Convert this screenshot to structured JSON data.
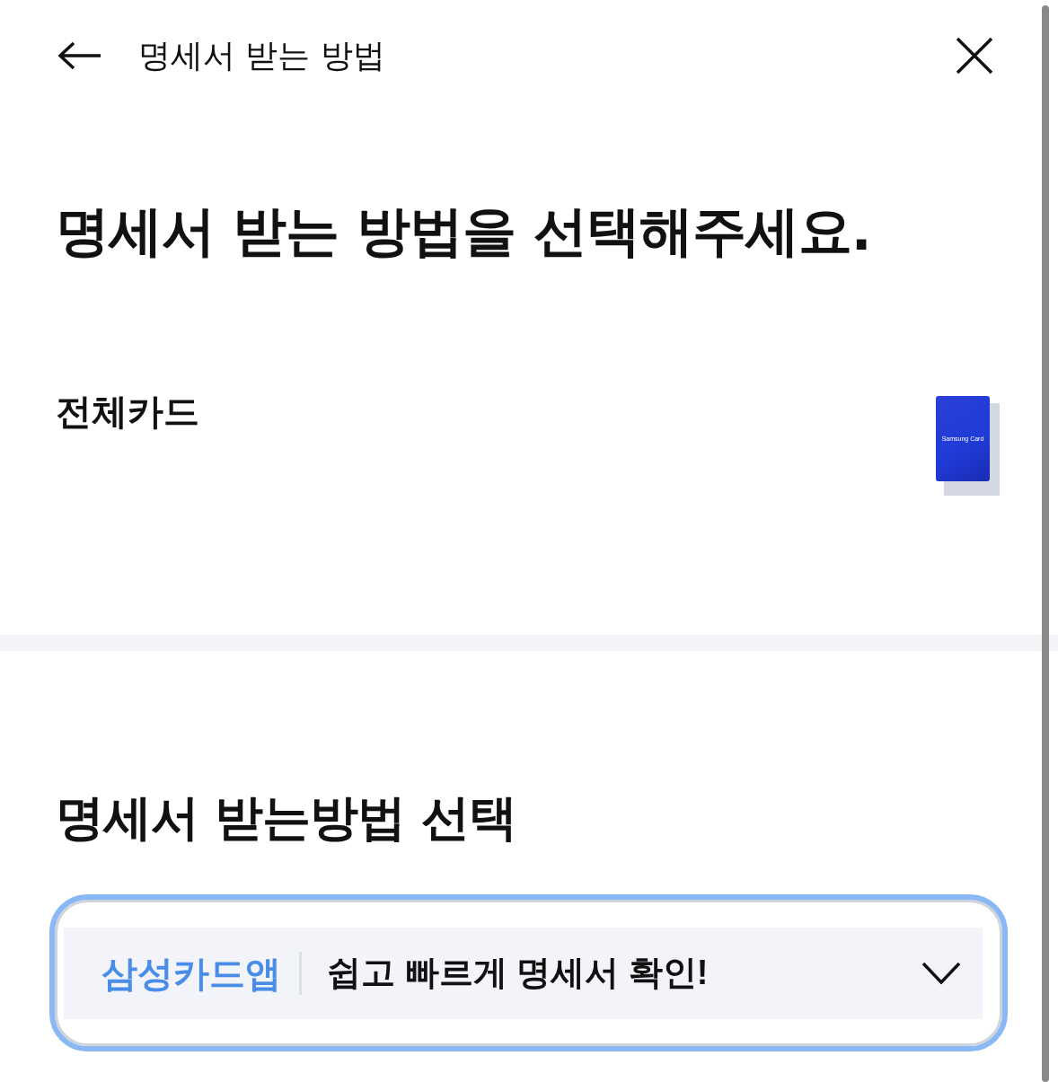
{
  "header": {
    "title": "명세서 받는 방법"
  },
  "headline": "명세서 받는 방법을 선택해주세요.",
  "card_section": {
    "label": "전체카드",
    "card_text": "Samsung Card"
  },
  "method_section": {
    "title": "명세서 받는방법 선택",
    "dropdown": {
      "selected_label": "삼성카드앱",
      "description": "쉽고 빠르게 명세서 확인!",
      "focused": true
    }
  }
}
